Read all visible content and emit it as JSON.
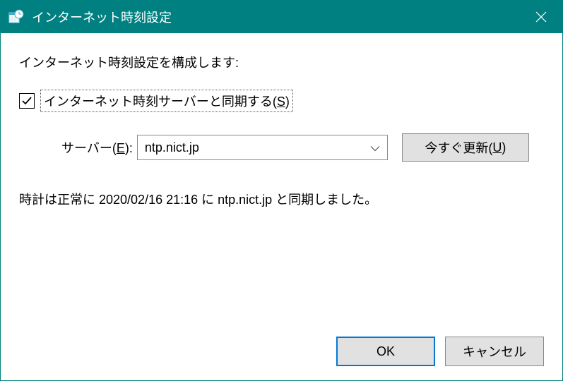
{
  "title": "インターネット時刻設定",
  "instruction": "インターネット時刻設定を構成します:",
  "sync_checkbox": {
    "checked": true,
    "label_prefix": "インターネット時刻サーバーと同期する(",
    "label_key": "S",
    "label_suffix": ")"
  },
  "server": {
    "label_prefix": "サーバー(",
    "label_key": "E",
    "label_suffix": "):",
    "value": "ntp.nict.jp"
  },
  "update_btn": {
    "label_prefix": "今すぐ更新(",
    "label_key": "U",
    "label_suffix": ")"
  },
  "status_text": "時計は正常に 2020/02/16 21:16 に ntp.nict.jp と同期しました。",
  "ok_label": "OK",
  "cancel_label": "キャンセル"
}
